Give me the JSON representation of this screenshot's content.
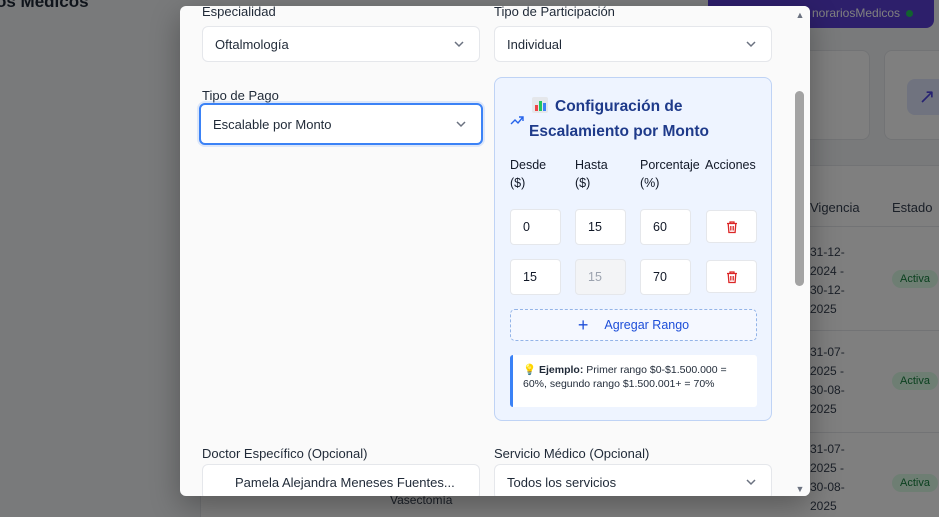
{
  "background": {
    "title": "os Médicos",
    "badge": "norariosMedicos",
    "table_headers": {
      "vigencia": "Vigencia",
      "estado": "Estado"
    },
    "rows": [
      {
        "dates": "31-12-2024 - 30-12-2025",
        "status": "Activa"
      },
      {
        "dates": "31-07-2025 - 30-08-2025",
        "status": "Activa"
      },
      {
        "dates": "31-07-2025 - 30-08-2025",
        "status": "Activa"
      }
    ],
    "row_text": "Vasectomía"
  },
  "form": {
    "especialidad": {
      "label": "Especialidad",
      "value": "Oftalmología"
    },
    "tipo_participacion": {
      "label": "Tipo de Participación",
      "value": "Individual"
    },
    "tipo_pago": {
      "label": "Tipo de Pago",
      "value": "Escalable por Monto"
    },
    "doctor": {
      "label": "Doctor Específico (Opcional)",
      "value": "Pamela Alejandra Meneses Fuentes..."
    },
    "servicio": {
      "label": "Servicio Médico (Opcional)",
      "value": "Todos los servicios"
    }
  },
  "config": {
    "title": "Configuración de Escalamiento por Monto",
    "columns": {
      "desde": "Desde ($)",
      "hasta": "Hasta ($)",
      "porcentaje": "Porcentaje (%)",
      "acciones": "Acciones"
    },
    "ranges": [
      {
        "desde": "0",
        "hasta": "15",
        "porcentaje": "60",
        "hasta_disabled": false
      },
      {
        "desde": "15",
        "hasta": "15",
        "porcentaje": "70",
        "hasta_disabled": true
      }
    ],
    "add_label": "Agregar Rango",
    "example_label": "Ejemplo:",
    "example_text": " Primer rango $0-$1.500.000 = 60%, segundo rango $1.500.001+ = 70%"
  },
  "icons": {
    "trend": "trending-up-icon",
    "chart": "bar-chart-icon",
    "delete": "trash-icon",
    "chevron": "chevron-down-icon",
    "bulb": "lightbulb-icon"
  },
  "colors": {
    "accent": "#3b82f6",
    "danger": "#dc2626",
    "panel_bg": "#eef4ff",
    "badge": "#5b3fd6"
  }
}
